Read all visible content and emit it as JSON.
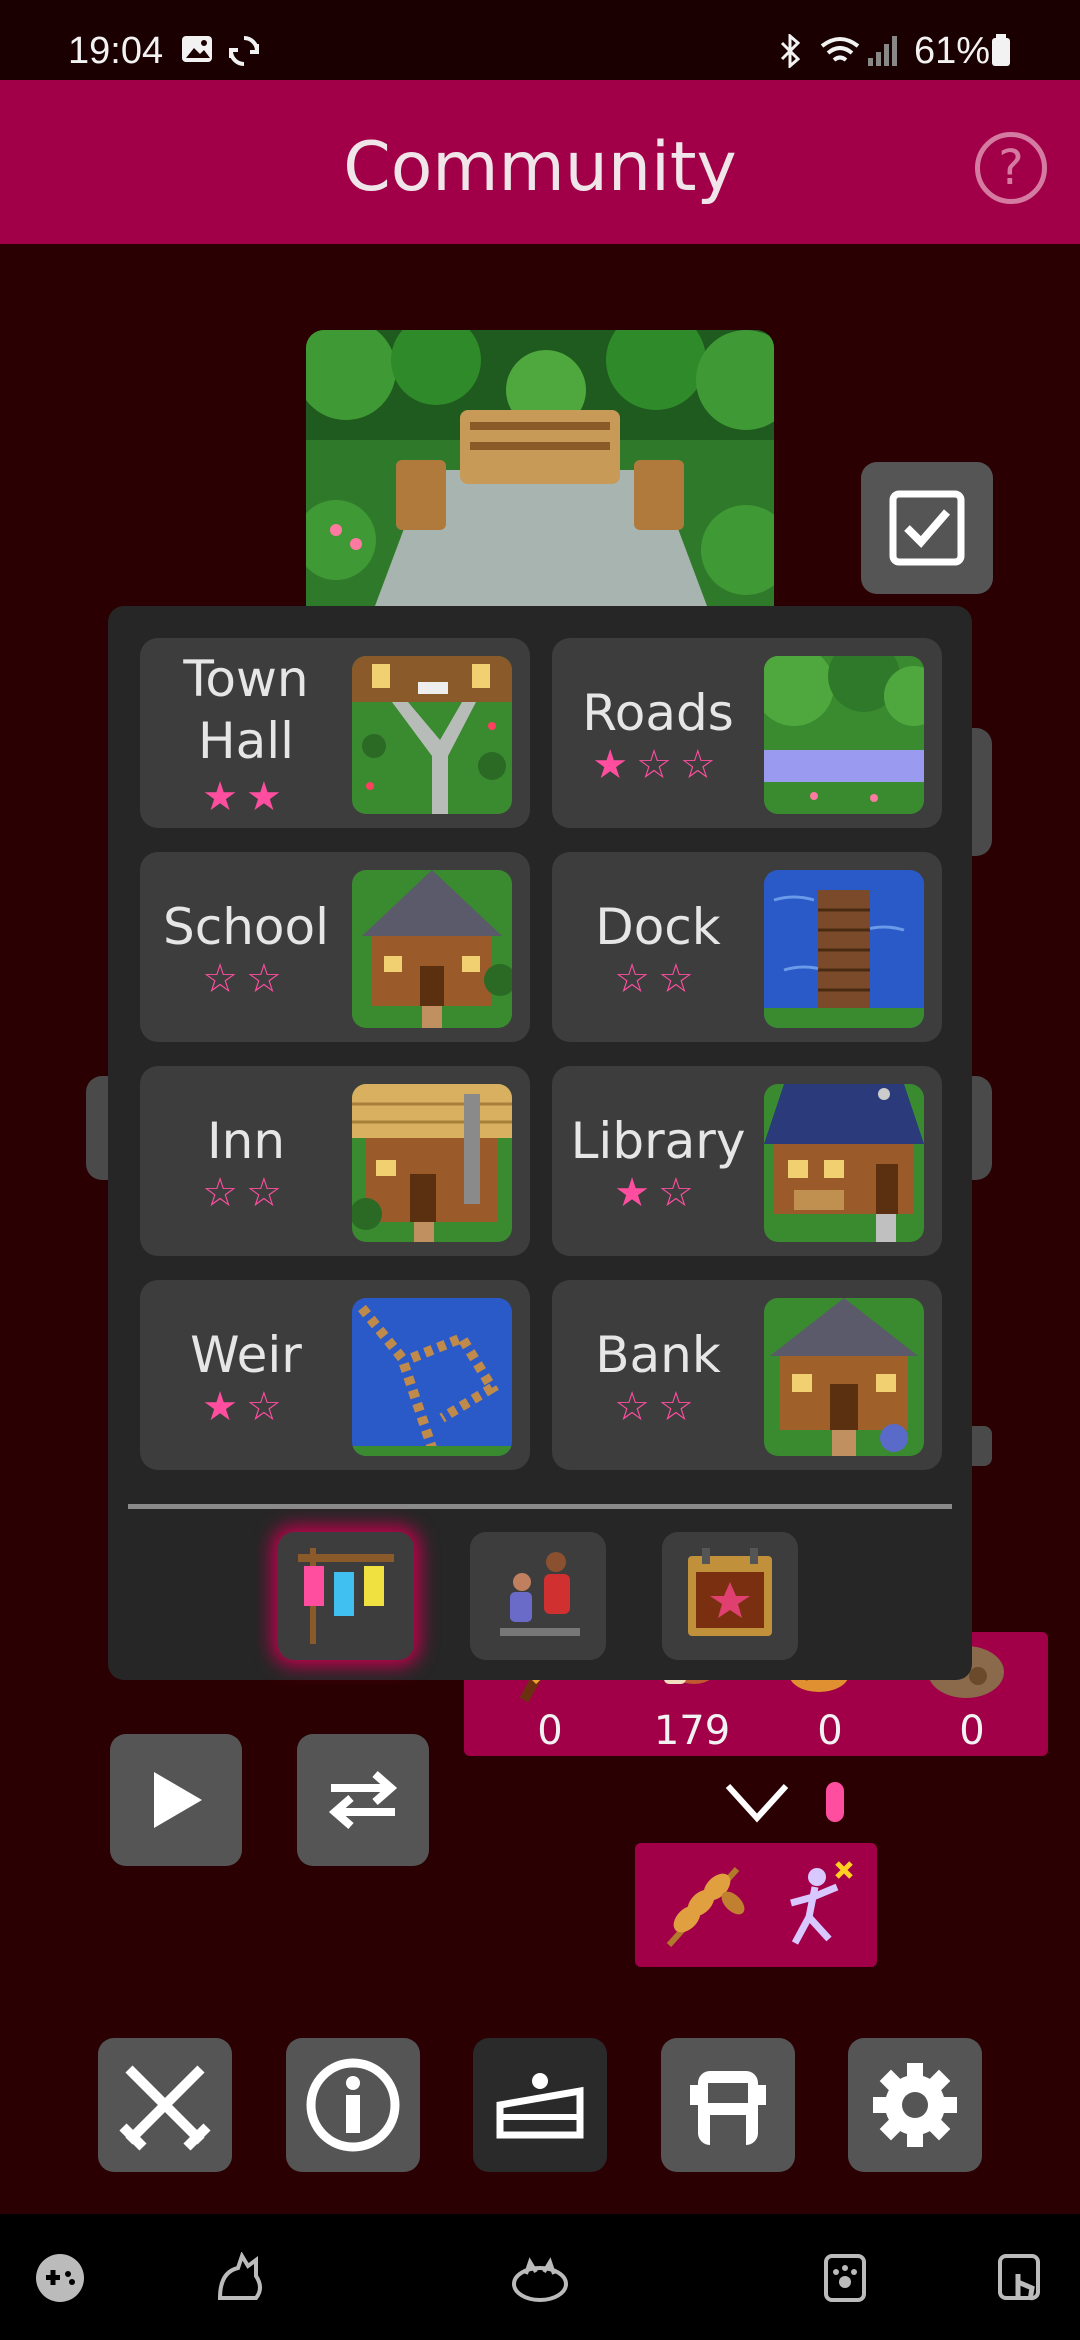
{
  "status_bar": {
    "time": "19:04",
    "battery": "61%"
  },
  "header": {
    "title": "Community",
    "help_label": "?"
  },
  "buildings": [
    {
      "name": "Town Hall",
      "stars": "★★"
    },
    {
      "name": "Roads",
      "stars": "★☆☆"
    },
    {
      "name": "School",
      "stars": "☆☆"
    },
    {
      "name": "Dock",
      "stars": "☆☆"
    },
    {
      "name": "Inn",
      "stars": "☆☆"
    },
    {
      "name": "Library",
      "stars": "★☆"
    },
    {
      "name": "Weir",
      "stars": "★☆"
    },
    {
      "name": "Bank",
      "stars": "☆☆"
    }
  ],
  "resources": [
    "0",
    "179",
    "0",
    "0"
  ],
  "popup_tabs": [
    "festival-banners-icon",
    "villagers-icon",
    "event-calendar-icon"
  ],
  "bottom_buttons": [
    "combat-swords-icon",
    "info-icon",
    "cake-icon",
    "backpack-icon",
    "settings-gear-icon"
  ],
  "colors": {
    "accent": "#a10049",
    "background": "#2b0003",
    "card": "#3d3d3d",
    "star": "#ff4ea0"
  }
}
